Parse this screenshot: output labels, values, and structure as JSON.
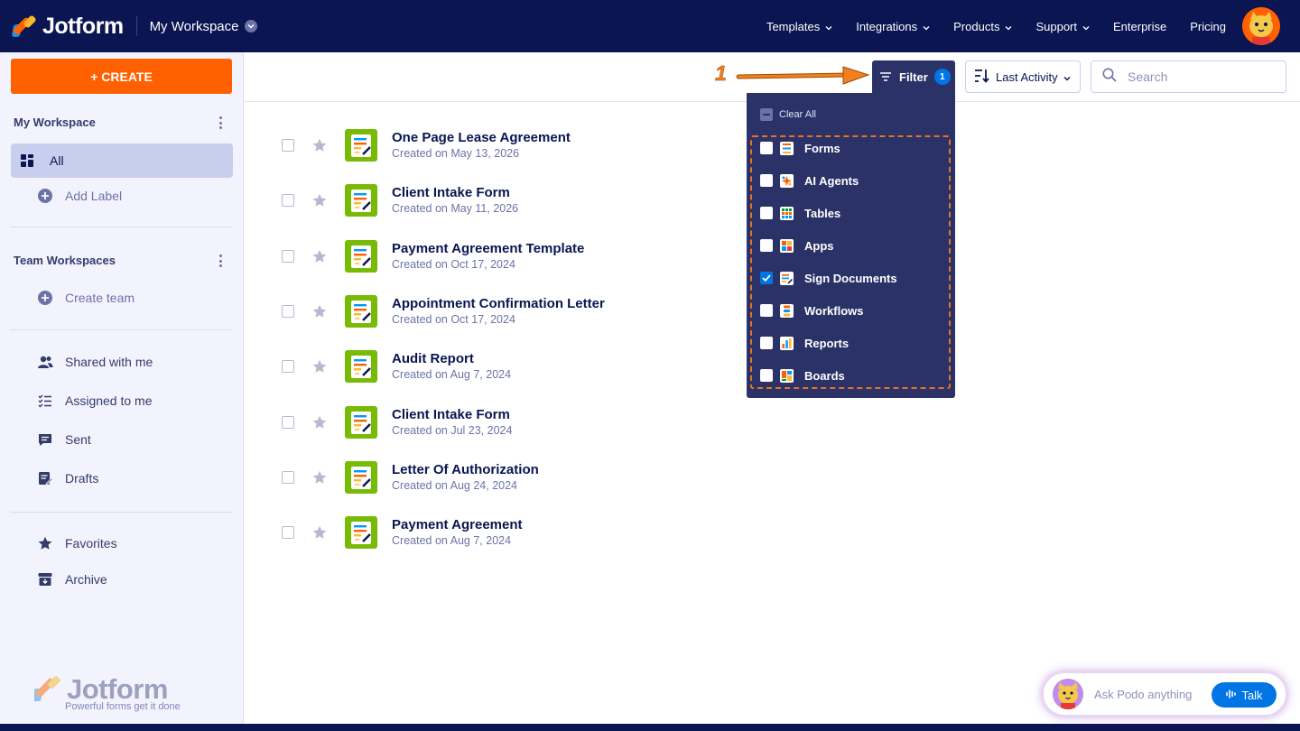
{
  "header": {
    "brand": "Jotform",
    "workspace": "My Workspace",
    "nav": [
      {
        "label": "Templates",
        "dropdown": true
      },
      {
        "label": "Integrations",
        "dropdown": true
      },
      {
        "label": "Products",
        "dropdown": true
      },
      {
        "label": "Support",
        "dropdown": true
      },
      {
        "label": "Enterprise",
        "dropdown": false
      },
      {
        "label": "Pricing",
        "dropdown": false
      }
    ]
  },
  "sidebar": {
    "create_label": "+ CREATE",
    "my_workspace_title": "My Workspace",
    "all_label": "All",
    "add_label": "Add Label",
    "team_title": "Team Workspaces",
    "create_team": "Create team",
    "shared": "Shared with me",
    "assigned": "Assigned to me",
    "sent": "Sent",
    "drafts": "Drafts",
    "favorites": "Favorites",
    "archive": "Archive",
    "brand_name": "Jotform",
    "brand_tagline": "Powerful forms get it done"
  },
  "toolbar": {
    "filter_label": "Filter",
    "filter_count": "1",
    "sort_label": "Last Activity",
    "search_placeholder": "Search"
  },
  "annotation": {
    "number": "1",
    "color": "#e8731f"
  },
  "filter_menu": {
    "clear_all": "Clear All",
    "items": [
      {
        "label": "Forms",
        "checked": false,
        "icon": "forms-icon"
      },
      {
        "label": "AI Agents",
        "checked": false,
        "icon": "ai-agents-icon"
      },
      {
        "label": "Tables",
        "checked": false,
        "icon": "tables-icon"
      },
      {
        "label": "Apps",
        "checked": false,
        "icon": "apps-icon"
      },
      {
        "label": "Sign Documents",
        "checked": true,
        "icon": "sign-documents-icon"
      },
      {
        "label": "Workflows",
        "checked": false,
        "icon": "workflows-icon"
      },
      {
        "label": "Reports",
        "checked": false,
        "icon": "reports-icon"
      },
      {
        "label": "Boards",
        "checked": false,
        "icon": "boards-icon"
      }
    ]
  },
  "documents": [
    {
      "title": "One Page Lease Agreement",
      "created": "Created on May 13, 2026"
    },
    {
      "title": "Client Intake Form",
      "created": "Created on May 11, 2026"
    },
    {
      "title": "Payment Agreement Template",
      "created": "Created on Oct 17, 2024"
    },
    {
      "title": "Appointment Confirmation Letter",
      "created": "Created on Oct 17, 2024"
    },
    {
      "title": "Audit Report",
      "created": "Created on Aug 7, 2024"
    },
    {
      "title": "Client Intake Form",
      "created": "Created on Jul 23, 2024"
    },
    {
      "title": "Letter Of Authorization",
      "created": "Created on Aug 24, 2024"
    },
    {
      "title": "Payment Agreement",
      "created": "Created on Aug 7, 2024"
    }
  ],
  "podo": {
    "prompt": "Ask Podo anything",
    "talk_label": "Talk"
  },
  "colors": {
    "navy": "#0a1551",
    "orange": "#ff6100",
    "blue": "#0075e3",
    "sign_green": "#78bb07"
  }
}
